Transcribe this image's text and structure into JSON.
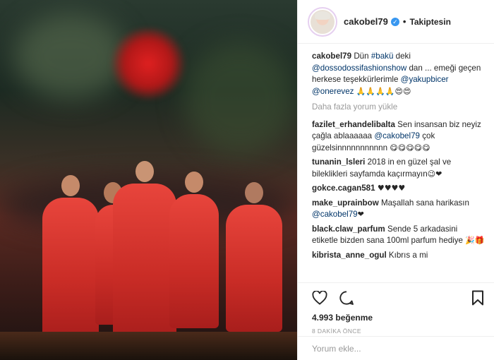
{
  "post": {
    "username": "cakobel79",
    "follow_label": "Takiptesin",
    "caption_user": "cakobel79",
    "caption_parts": {
      "p1": "Dün ",
      "tag": "#bakü",
      "p2": " deki",
      "mention1": "@dossodossifashionshow",
      "p3": " dan ... emeği geçen herkese teşekkürlerimle",
      "mention2": "@yakupbicer",
      "mention3": "@onerevez",
      "emojis": "🙏🙏🙏🙏😍😍"
    },
    "load_more": "Daha fazla yorum yükle",
    "likes": "4.993 beğenme",
    "time": "8 DAKİKA ÖNCE",
    "comment_placeholder": "Yorum ekle..."
  },
  "comments": [
    {
      "user": "fazilet_erhandelibalta",
      "text": "Sen insansan biz neyiz çağla ablaaaaaa",
      "mention": "@cakobel79",
      "text2": "çok güzelsinnnnnnnnnnn",
      "emoji": "😋😋😋😋😋"
    },
    {
      "user": "tunanin_lsleri",
      "text": "2018 in en güzel şal ve bileklikleri sayfamda kaçırmayın",
      "mention": "",
      "text2": "",
      "emoji": "😉❤"
    },
    {
      "user": "gokce.cagan581",
      "text": "",
      "mention": "",
      "text2": "",
      "emoji": "♥♥♥♥"
    },
    {
      "user": "make_uprainbow",
      "text": "Maşallah sana harikasın",
      "mention": "@cakobel79",
      "text2": "",
      "emoji": "❤"
    },
    {
      "user": "black.claw_parfum",
      "text": "Sende 5 arkadasini etiketle bizden sana 100ml parfum hediye",
      "mention": "",
      "text2": "",
      "emoji": "🎉🎁"
    },
    {
      "user": "kibrista_anne_ogul",
      "text": "Kıbrıs a mi",
      "mention": "",
      "text2": "",
      "emoji": ""
    }
  ],
  "icons": {
    "heart": "heart-icon",
    "comment": "comment-icon",
    "bookmark": "bookmark-icon",
    "verified": "verified-badge-icon"
  }
}
